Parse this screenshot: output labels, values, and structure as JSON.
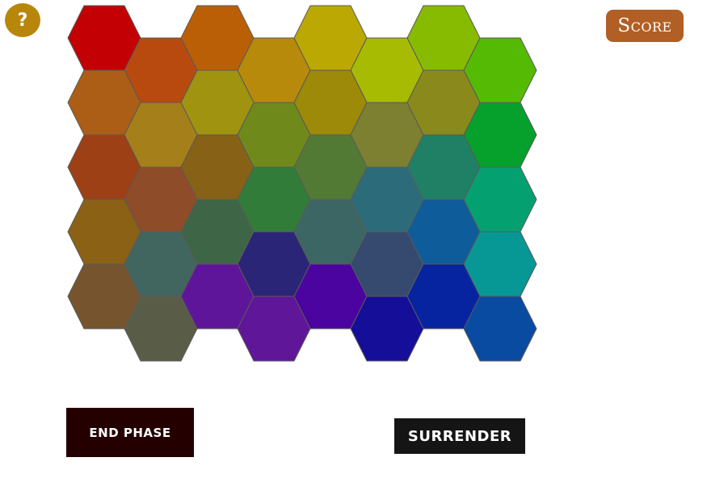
{
  "help": {
    "label": "?"
  },
  "score": {
    "label": "Score"
  },
  "buttons": {
    "end_phase": "END PHASE",
    "surrender": "SURRENDER"
  },
  "board": {
    "columns": 8,
    "rows": 5,
    "cells": [
      [
        "#c30003",
        "#b84a0f",
        "#bb5f06",
        "#b88a0b",
        "#bba803",
        "#a8bb03",
        "#87bb02",
        "#55ba04"
      ],
      [
        "#ac5e16",
        "#a5801a",
        "#a09310",
        "#6f8a1a",
        "#9c8a08",
        "#7c8030",
        "#8a8a1c",
        "#06a02c"
      ],
      [
        "#9e4016",
        "#8f4c29",
        "#876116",
        "#327c3a",
        "#527a35",
        "#2c6c7a",
        "#208066",
        "#05a070"
      ],
      [
        "#8b6115",
        "#416660",
        "#3e6646",
        "#2b2577",
        "#3c6663",
        "#354a6e",
        "#0e5c9a",
        "#079795"
      ],
      [
        "#76542e",
        "#595d48",
        "#5f1599",
        "#5f1699",
        "#4b04a0",
        "#150e98",
        "#0624a0",
        "#094ba0"
      ]
    ]
  }
}
